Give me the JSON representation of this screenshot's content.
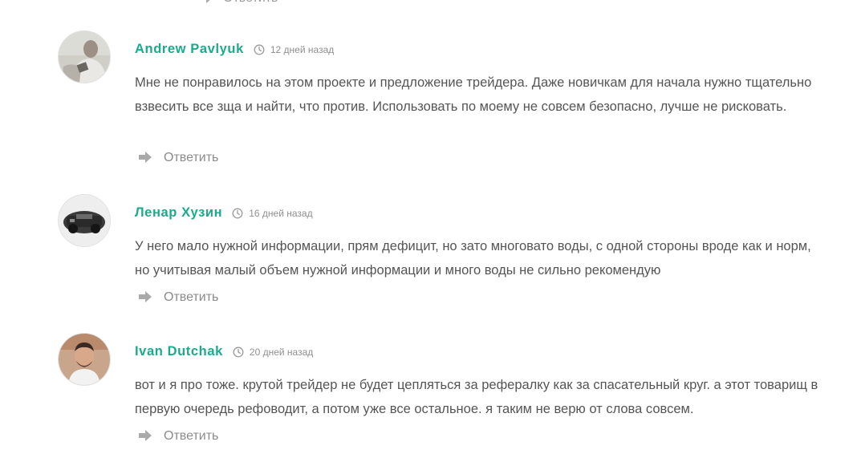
{
  "reply_label": "Ответить",
  "colors": {
    "author": "#1aab8b",
    "text": "#555555",
    "muted": "#8f8f8f"
  },
  "comments": [
    {
      "author": "Andrew Pavlyuk",
      "time": "12 дней назад",
      "text": "Мне не понравилось на этом проекте и предложение трейдера. Даже новичкам для начала нужно тщательно взвесить все зща и найти, что против. Использовать по моему не совсем безопасно, лучше не рисковать."
    },
    {
      "author": "Ленар Хузин",
      "time": "16 дней назад",
      "text": "У него мало нужной информации, прям дефицит, но зато многовато воды, с одной стороны вроде как и норм, но учитывая малый объем нужной информации и много воды не сильно рекомендую"
    },
    {
      "author": "Ivan Dutchak",
      "time": "20 дней назад",
      "text": "вот и я про тоже. крутой трейдер не будет цепляться за рефералку как за спасательный круг. а этот товарищ в первую очередь рефоводит, а потом уже все остальное. я таким не верю от слова совсем."
    }
  ]
}
